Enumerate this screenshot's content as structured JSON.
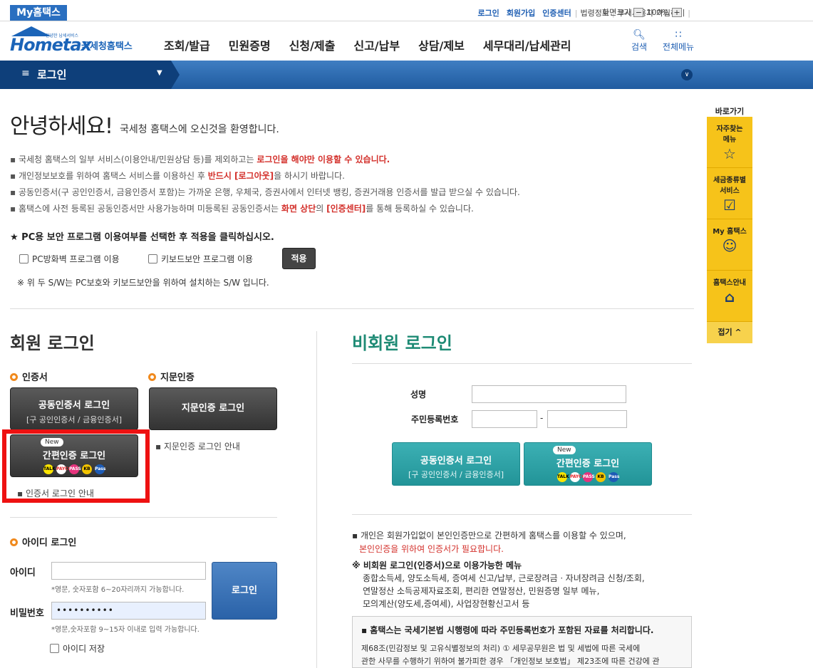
{
  "topbar": {
    "my_hometax": "My홈택스",
    "links": [
      "로그인",
      "회원가입",
      "인증센터"
    ],
    "sub_links": [
      "법령정보",
      "부서사용자 가입하기"
    ],
    "zoom_label": "화면크기",
    "zoom_minus": "−",
    "zoom_value": "100%",
    "zoom_plus": "+"
  },
  "header": {
    "logo_text": "Hometax",
    "logo_small": "안녕한 납세서비스",
    "logo_name": "국세청홈택스",
    "nav": [
      "조회/발급",
      "민원증명",
      "신청/제출",
      "신고/납부",
      "상담/제보",
      "세무대리/납세관리"
    ],
    "search_label": "검색",
    "allmenu_label": "전체메뉴"
  },
  "location": {
    "title": "로그인"
  },
  "greeting": {
    "title": "안녕하세요!",
    "subtitle": "국세청 홈택스에 오신것을 환영합니다."
  },
  "notices": {
    "n1a": "국세청 홈택스의 일부 서비스(이용안내/민원상담 등)를 제외하고는 ",
    "n1b": "로그인을 해야만 이용할 수 있습니다.",
    "n2a": "개인정보보호를 위하여 홈택스 서비스를 이용하신 후 ",
    "n2b": "반드시 [로그아웃]",
    "n2c": "을 하시기 바랍니다.",
    "n3": "공동인증서(구 공인인증서, 금융인증서 포함)는 가까운 은행, 우체국, 증권사에서 인터넷 뱅킹, 증권거래용 인증서를 발급 받으실 수 있습니다.",
    "n4a": "홈택스에 사전 등록된 공동인증서만 사용가능하며 미등록된 공동인증서는 ",
    "n4b": "화면 상단",
    "n4c": "의 ",
    "n4d": "[인증센터]",
    "n4e": "를 통해 등록하실 수 있습니다."
  },
  "pc_security": {
    "title": "★ PC용 보안 프로그램 이용여부를 선택한 후 적용을 클릭하십시오.",
    "cb_firewall": "PC방화벽 프로그램 이용",
    "cb_keyboard": "키보드보안 프로그램 이용",
    "apply": "적용",
    "note": "※ 위 두 S/W는 PC보호와 키보드보안을 위하여 설치하는 S/W 입니다."
  },
  "member": {
    "title": "회원 로그인",
    "cert_section": "인증서",
    "fp_section": "지문인증",
    "cert_btn_main": "공동인증서 로그인",
    "cert_btn_sub": "[구 공인인증서 / 금융인증서]",
    "fp_btn": "지문인증 로그인",
    "simple_btn": "간편인증 로그인",
    "new_badge": "New",
    "cert_guide": "인증서 로그인 안내",
    "fp_guide": "지문인증 로그인 안내",
    "id_section": "아이디 로그인",
    "id_label": "아이디",
    "id_value": "",
    "id_hint": "*영문, 숫자포함 6~20자리까지 가능합니다.",
    "pw_label": "비밀번호",
    "pw_value": "••••••••••",
    "pw_hint": "*영문,숫자포함 9~15자 이내로 입력 가능합니다.",
    "login_btn": "로그인",
    "save_id": "아이디 저장",
    "providers": [
      "TALK",
      "PAYCO",
      "PASS",
      "KB",
      "Pass"
    ]
  },
  "nonmember": {
    "title": "비회원 로그인",
    "name_label": "성명",
    "rrn_label": "주민등록번호",
    "rrn_dash": "-",
    "cert_btn_main": "공동인증서 로그인",
    "cert_btn_sub": "[구 공인인증서 / 금융인증서]",
    "simple_btn": "간편인증 로그인",
    "new_badge": "New",
    "note1": "개인은 회원가입없이 본인인증만으로 간편하게 홈택스를 이용할 수 있으며,",
    "note2": "본인인증을 위하여 인증서가 필요합니다.",
    "menu_title": "※ 비회원 로그인(인증서)으로 이용가능한 메뉴",
    "menu_lines": [
      "종합소득세, 양도소득세, 증여세 신고/납부, 근로장려금ㆍ자녀장려금 신청/조회,",
      "연말정산 소득공제자료조회, 편리한 연말정산, 민원증명 일부 메뉴,",
      "모의계산(양도세,증여세), 사업장현황신고서 등"
    ],
    "rrn_box_title": "▪ 홈택스는 국세기본법 시행령에 따라 주민등록번호가 포함된 자료를 처리합니다.",
    "rrn_box_l1": "제68조(민감정보 및 고유식별정보의 처리) ① 세무공무원은 법 및 세법에 따른 국세에",
    "rrn_box_l2": "관한 사무를 수행하기 위하여 불가피한 경우 「개인정보 보호법」 제23조에 따른 건강에 관"
  },
  "quick": {
    "title": "바로가기",
    "items": [
      "자주찾는\n메뉴",
      "세금종류별\n서비스",
      "My 홈택스",
      "홈택스안내"
    ],
    "fold": "접기 ^"
  }
}
